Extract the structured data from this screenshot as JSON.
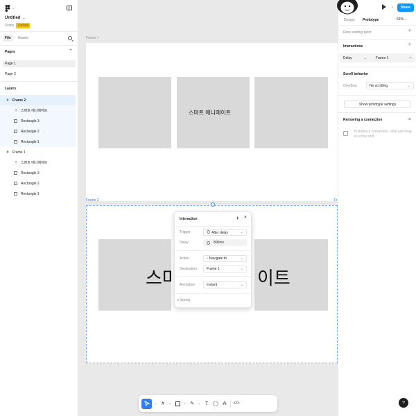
{
  "left_panel": {
    "file_title": "Untitled",
    "file_subtitle": "Drafts",
    "locked_badge": "Locked",
    "tabs": [
      {
        "label": "File"
      },
      {
        "label": "Assets"
      }
    ],
    "pages_title": "Pages",
    "pages": [
      {
        "label": "Page 1"
      },
      {
        "label": "Page 2"
      }
    ],
    "layers_title": "Layers",
    "layers": [
      {
        "label": "Frame 2",
        "type": "frame"
      },
      {
        "label": "스마트 애니메이트",
        "type": "text"
      },
      {
        "label": "Rectangle 3",
        "type": "rect"
      },
      {
        "label": "Rectangle 2",
        "type": "rect"
      },
      {
        "label": "Rectangle 1",
        "type": "rect"
      },
      {
        "label": "Frame 1",
        "type": "frame"
      },
      {
        "label": "스마트 애니메이트",
        "type": "text"
      },
      {
        "label": "Rectangle 3",
        "type": "rect"
      },
      {
        "label": "Rectangle 2",
        "type": "rect"
      },
      {
        "label": "Rectangle 1",
        "type": "rect"
      }
    ]
  },
  "canvas": {
    "frame1_label": "Frame 1",
    "frame2_label": "Frame 2",
    "frame2_label_right": "Fr",
    "frame1_text": "스마트 애니메이트",
    "frame2_text_left": "스마",
    "frame2_text_right": "이트",
    "colors": {
      "rect": "#d9d9d9",
      "selection": "#2f80ed"
    }
  },
  "popup": {
    "title": "Interaction",
    "trigger_label": "Trigger",
    "trigger_value": "After delay",
    "delay_label": "Delay",
    "delay_value": "800ms",
    "action_label": "Action",
    "action_value": "Navigate to",
    "destination_label": "Destination",
    "destination_value": "Frame 1",
    "animation_label": "Animation",
    "animation_value": "Instant",
    "spring_label": "Spring"
  },
  "toolbar": {
    "tools": [
      "move-tool",
      "frame-tool",
      "shape-tool",
      "pen-tool",
      "text-tool",
      "comment-tool",
      "actions-tool",
      "dev-mode-toggle"
    ]
  },
  "right_panel": {
    "share_label": "Share",
    "tabs": [
      {
        "label": "Design"
      },
      {
        "label": "Prototype"
      }
    ],
    "zoom": "61%",
    "flow_label": "Flow starting point",
    "interactions_label": "Interactions",
    "interaction_trigger": "Delay",
    "interaction_dest": "Frame 1",
    "scroll_label": "Scroll behavior",
    "overflow_label": "Overflow",
    "overflow_value": "No scrolling",
    "proto_settings_label": "Show prototype settings",
    "removing_title": "Removing a connection",
    "removing_hint": "To delete a connection, click and drag on a free end.",
    "help": "?"
  }
}
